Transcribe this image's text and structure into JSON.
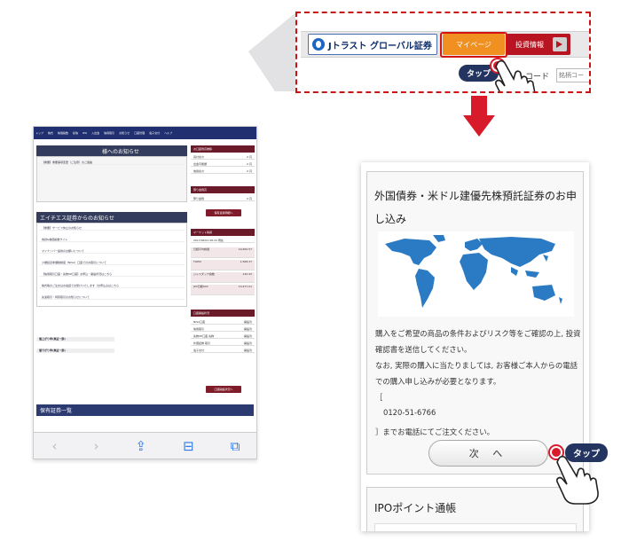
{
  "header_zoom": {
    "logo_text": "Jトラスト グローバル証券",
    "mypage_label": "マイページ",
    "invest_label": "投資情報",
    "code_label": "コード",
    "code_placeholder": "銘柄コー",
    "tap_label": "タップ"
  },
  "left_screen": {
    "nav_items": [
      "トップ",
      "株式",
      "株価指数",
      "投信",
      "IPO",
      "入出金",
      "信用取引",
      "お知らせ",
      "口座管理",
      "電子交付",
      "ヘルプ"
    ],
    "notice_title": "様へのお知らせ",
    "notice_row": "【重要】重要事項変更（ご注意）のご連絡",
    "company_notice_title": "エイチエス証券からのお知らせ",
    "company_notice_rows": [
      "【重要】サービス休止のお知らせ",
      "為替&株価指数サイト",
      "マイナンバー提供のお願いについて",
      "少額投資非課税制度（NISA）口座でのお取引について",
      "【信用取引口座・先物OP口座】お申込・開設状況はこちら",
      "株式等のご注文はお電話でお受けいたします（お申込みはこちら",
      "先渡取引・特別取引のお知らせについて"
    ],
    "rankings": [
      "値上がり率(東証一部)",
      "値下がり率(東証一部)"
    ],
    "holdings_title": "保有証券一覧",
    "side_asset_title": "お口座残高推移",
    "side_asset_rows": [
      [
        "買付余力",
        "0 円"
      ],
      [
        "出金可能額",
        "0 円"
      ],
      [
        "信用余力",
        "0 円"
      ]
    ],
    "side_buy_title": "預り金残高",
    "side_buy_rows": [
      [
        "預り金残",
        "0 円"
      ]
    ],
    "side_buy_button": "保有資産明細へ",
    "market_title": "マーケット情報",
    "market_date": "2017/06/01 08:24 現在",
    "market_rows": [
      [
        "日経平均株価",
        "19,650.57"
      ],
      [
        "TOPIX",
        "1,568.37"
      ],
      [
        "ジャスダック指数",
        "140.42"
      ],
      [
        "JPX日経400",
        "13,977.01"
      ]
    ],
    "status_title": "口座開設状況",
    "status_rows": [
      [
        "NISA口座",
        "開設済"
      ],
      [
        "信用取引",
        "開設済"
      ],
      [
        "先物OP口座 先物",
        "開設済"
      ],
      [
        "外国証券 取引",
        "開設済"
      ],
      [
        "電子交付",
        "開設済"
      ]
    ],
    "status_button": "口座開設状況へ",
    "toolbar": {
      "back": "‹",
      "forward": "›",
      "share": "⇪",
      "book": "⊟",
      "tabs": "⧉"
    }
  },
  "right_screen": {
    "title": "外国債券・米ドル建優先株預託証券のお申し込み",
    "desc_lines": [
      "購入をご希望の商品の条件およびリスク等をご確認の上, 投資",
      "確認書を送信してください。",
      "なお, 実際の購入に当たりましては, お客様ご本人からの電話",
      "での購入申し込みが必要となります。",
      "［",
      "0120-51-6766",
      "］までお電話にてご注文ください。"
    ],
    "next_button": "次 へ",
    "tap_label": "タップ",
    "ipo_title": "IPOポイント通帳"
  },
  "colors": {
    "accent_red": "#d41313",
    "brand_navy": "#22345f",
    "mypage_orange": "#ef9021",
    "invest_red": "#b81421",
    "map_blue": "#2b7bc4"
  }
}
